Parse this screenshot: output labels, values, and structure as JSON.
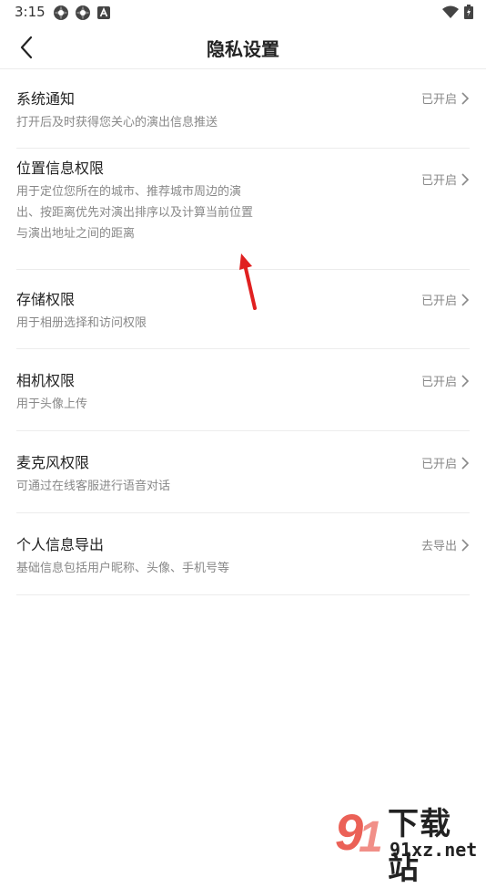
{
  "status_bar": {
    "time": "3:15",
    "left_icons": [
      "app-notification-icon",
      "app-notification-icon",
      "text-a-icon"
    ],
    "right_icons": [
      "wifi-icon",
      "battery-charging-icon"
    ]
  },
  "header": {
    "title": "隐私设置",
    "back_icon": "chevron-left-icon"
  },
  "settings": {
    "items": [
      {
        "title": "系统通知",
        "desc_lines": [
          "打开后及时获得您关心的演出信息推送"
        ],
        "status": "已开启"
      },
      {
        "title": "位置信息权限",
        "desc_lines": [
          "用于定位您所在的城市、推荐城市周边的演",
          "出、按距离优先对演出排序以及计算当前位置",
          "与演出地址之间的距离"
        ],
        "status": "已开启"
      },
      {
        "title": "存储权限",
        "desc_lines": [
          "用于相册选择和访问权限"
        ],
        "status": "已开启"
      },
      {
        "title": "相机权限",
        "desc_lines": [
          "用于头像上传"
        ],
        "status": "已开启"
      },
      {
        "title": "麦克风权限",
        "desc_lines": [
          "可通过在线客服进行语音对话"
        ],
        "status": "已开启"
      },
      {
        "title": "个人信息导出",
        "desc_lines": [
          "基础信息包括用户昵称、头像、手机号等"
        ],
        "status": "去导出"
      }
    ]
  },
  "annotation": {
    "icon": "red-arrow-icon",
    "color": "#e02020"
  },
  "watermark": {
    "name": "下载站",
    "url": "91xz.net",
    "logo": "91-logo",
    "accent": "#e8463a"
  }
}
